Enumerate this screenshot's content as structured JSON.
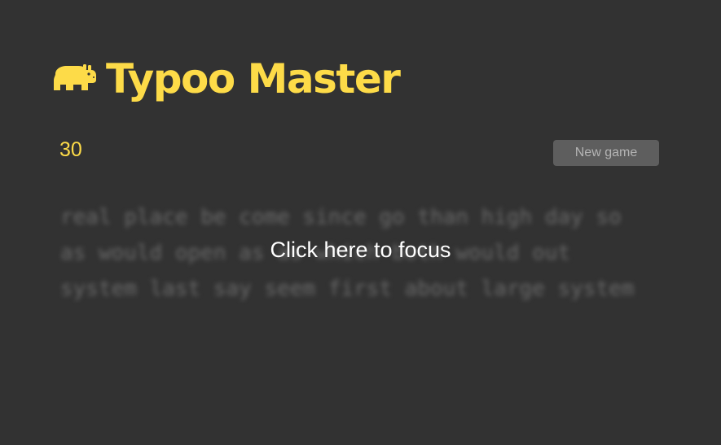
{
  "header": {
    "logo_icon": "hippo-icon",
    "title": "Typoo Master"
  },
  "game": {
    "timer": "30",
    "new_game_label": "New game",
    "words": [
      "real place be come since go than high day so",
      "as would open as as which both would out",
      "system last say seem first about large system"
    ],
    "focus_prompt": "Click here to focus"
  },
  "colors": {
    "background": "#323232",
    "accent": "#fddb48",
    "button_bg": "#5e5e5e",
    "button_text": "#b4b4b4",
    "words_text": "#6a6a6a"
  }
}
